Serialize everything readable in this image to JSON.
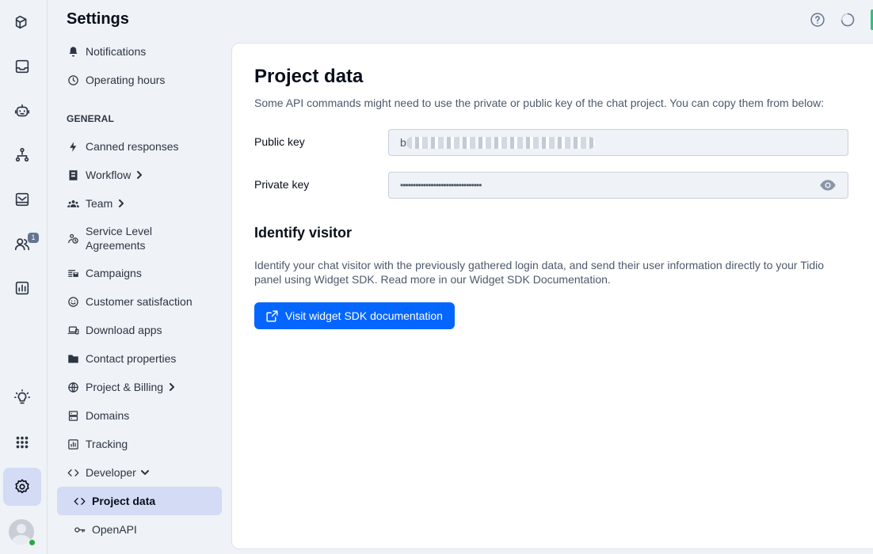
{
  "sidebar_rail": {
    "items": [
      {
        "name": "inbox-icon"
      },
      {
        "name": "tray-icon"
      },
      {
        "name": "bot-icon"
      },
      {
        "name": "flows-icon"
      },
      {
        "name": "mail-icon"
      },
      {
        "name": "contacts-icon",
        "badge": "1"
      },
      {
        "name": "analytics-icon"
      },
      {
        "name": "lightbulb-icon"
      },
      {
        "name": "apps-grid-icon"
      },
      {
        "name": "settings-icon"
      }
    ]
  },
  "settings_nav": {
    "title": "Settings",
    "top_items": [
      {
        "label": "Notifications",
        "icon": "bell-icon"
      },
      {
        "label": "Operating hours",
        "icon": "clock-icon"
      }
    ],
    "general_heading": "GENERAL",
    "general_items": [
      {
        "label": "Canned responses",
        "icon": "bolt-icon"
      },
      {
        "label": "Workflow",
        "icon": "workflow-icon",
        "chevron": "right"
      },
      {
        "label": "Team",
        "icon": "team-icon",
        "chevron": "right"
      },
      {
        "label": "Service Level Agreements",
        "icon": "sla-icon"
      },
      {
        "label": "Campaigns",
        "icon": "campaigns-icon"
      },
      {
        "label": "Customer satisfaction",
        "icon": "smiley-icon"
      },
      {
        "label": "Download apps",
        "icon": "devices-icon"
      },
      {
        "label": "Contact properties",
        "icon": "folder-icon"
      },
      {
        "label": "Project & Billing",
        "icon": "globe-icon",
        "chevron": "right"
      },
      {
        "label": "Domains",
        "icon": "server-icon"
      },
      {
        "label": "Tracking",
        "icon": "chart-icon"
      },
      {
        "label": "Developer",
        "icon": "code-icon",
        "chevron": "down"
      },
      {
        "label": "Project data",
        "icon": "code-icon",
        "active": true
      },
      {
        "label": "OpenAPI",
        "icon": "key-icon"
      }
    ]
  },
  "header": {
    "help_icon": "help-circle-icon",
    "status_icon": "loading-ring-icon"
  },
  "main": {
    "title": "Project data",
    "description": "Some API commands might need to use the private or public key of the chat project. You can copy them from below:",
    "public_key": {
      "label": "Public key",
      "value": "b"
    },
    "private_key": {
      "label": "Private key",
      "value": "••••••••••••••••••••••••••••••••"
    },
    "identify": {
      "title": "Identify visitor",
      "text": "Identify your chat visitor with the previously gathered login data, and send their user information directly to your Tidio panel using Widget SDK. Read more in our Widget SDK Documentation.",
      "button_label": "Visit widget SDK documentation"
    }
  },
  "colors": {
    "accent": "#0566ff",
    "active_nav_bg": "#d3dbf5",
    "page_bg": "#eff2f6",
    "online": "#28a745"
  }
}
